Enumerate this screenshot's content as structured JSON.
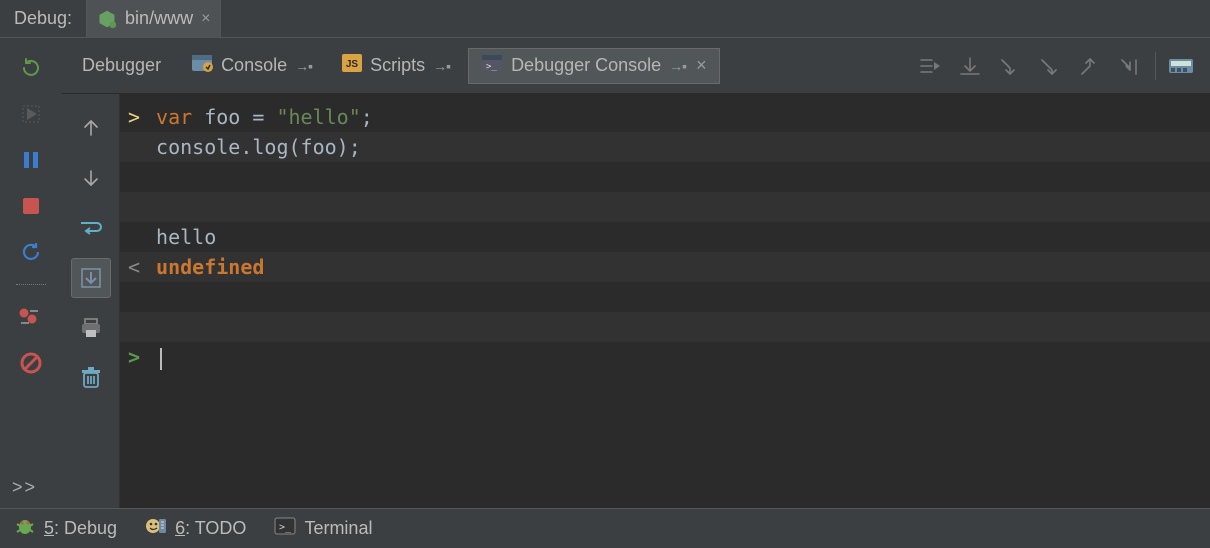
{
  "header": {
    "title": "Debug:",
    "file_tab": {
      "label": "bin/www"
    }
  },
  "tabs": {
    "debugger": "Debugger",
    "console": "Console",
    "scripts": "Scripts",
    "debugger_console": "Debugger Console"
  },
  "console": {
    "input_code_line1_kw": "var",
    "input_code_line1_rest": " foo = ",
    "input_code_line1_str": "\"hello\"",
    "input_code_line1_tail": ";",
    "input_code_line2": "console.log(foo);",
    "output1": "hello",
    "return_value": "undefined",
    "prompt_prefix": ">",
    "input_prefix": ">",
    "output_prefix": "<"
  },
  "status": {
    "debug_key": "5",
    "debug_label": ": Debug",
    "todo_key": "6",
    "todo_label": ": TODO",
    "terminal": "Terminal"
  }
}
